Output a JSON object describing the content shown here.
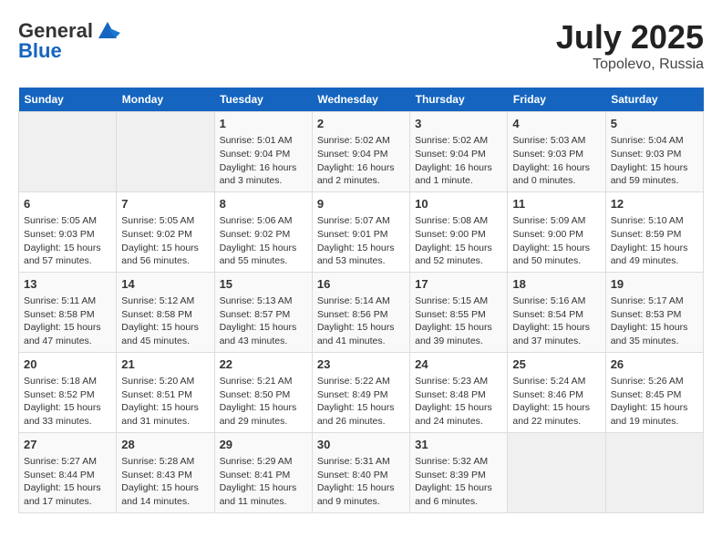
{
  "header": {
    "logo_general": "General",
    "logo_blue": "Blue",
    "month_year": "July 2025",
    "location": "Topolevo, Russia"
  },
  "calendar": {
    "days_of_week": [
      "Sunday",
      "Monday",
      "Tuesday",
      "Wednesday",
      "Thursday",
      "Friday",
      "Saturday"
    ],
    "weeks": [
      [
        {
          "day": "",
          "info": ""
        },
        {
          "day": "",
          "info": ""
        },
        {
          "day": "1",
          "info": "Sunrise: 5:01 AM\nSunset: 9:04 PM\nDaylight: 16 hours\nand 3 minutes."
        },
        {
          "day": "2",
          "info": "Sunrise: 5:02 AM\nSunset: 9:04 PM\nDaylight: 16 hours\nand 2 minutes."
        },
        {
          "day": "3",
          "info": "Sunrise: 5:02 AM\nSunset: 9:04 PM\nDaylight: 16 hours\nand 1 minute."
        },
        {
          "day": "4",
          "info": "Sunrise: 5:03 AM\nSunset: 9:03 PM\nDaylight: 16 hours\nand 0 minutes."
        },
        {
          "day": "5",
          "info": "Sunrise: 5:04 AM\nSunset: 9:03 PM\nDaylight: 15 hours\nand 59 minutes."
        }
      ],
      [
        {
          "day": "6",
          "info": "Sunrise: 5:05 AM\nSunset: 9:03 PM\nDaylight: 15 hours\nand 57 minutes."
        },
        {
          "day": "7",
          "info": "Sunrise: 5:05 AM\nSunset: 9:02 PM\nDaylight: 15 hours\nand 56 minutes."
        },
        {
          "day": "8",
          "info": "Sunrise: 5:06 AM\nSunset: 9:02 PM\nDaylight: 15 hours\nand 55 minutes."
        },
        {
          "day": "9",
          "info": "Sunrise: 5:07 AM\nSunset: 9:01 PM\nDaylight: 15 hours\nand 53 minutes."
        },
        {
          "day": "10",
          "info": "Sunrise: 5:08 AM\nSunset: 9:00 PM\nDaylight: 15 hours\nand 52 minutes."
        },
        {
          "day": "11",
          "info": "Sunrise: 5:09 AM\nSunset: 9:00 PM\nDaylight: 15 hours\nand 50 minutes."
        },
        {
          "day": "12",
          "info": "Sunrise: 5:10 AM\nSunset: 8:59 PM\nDaylight: 15 hours\nand 49 minutes."
        }
      ],
      [
        {
          "day": "13",
          "info": "Sunrise: 5:11 AM\nSunset: 8:58 PM\nDaylight: 15 hours\nand 47 minutes."
        },
        {
          "day": "14",
          "info": "Sunrise: 5:12 AM\nSunset: 8:58 PM\nDaylight: 15 hours\nand 45 minutes."
        },
        {
          "day": "15",
          "info": "Sunrise: 5:13 AM\nSunset: 8:57 PM\nDaylight: 15 hours\nand 43 minutes."
        },
        {
          "day": "16",
          "info": "Sunrise: 5:14 AM\nSunset: 8:56 PM\nDaylight: 15 hours\nand 41 minutes."
        },
        {
          "day": "17",
          "info": "Sunrise: 5:15 AM\nSunset: 8:55 PM\nDaylight: 15 hours\nand 39 minutes."
        },
        {
          "day": "18",
          "info": "Sunrise: 5:16 AM\nSunset: 8:54 PM\nDaylight: 15 hours\nand 37 minutes."
        },
        {
          "day": "19",
          "info": "Sunrise: 5:17 AM\nSunset: 8:53 PM\nDaylight: 15 hours\nand 35 minutes."
        }
      ],
      [
        {
          "day": "20",
          "info": "Sunrise: 5:18 AM\nSunset: 8:52 PM\nDaylight: 15 hours\nand 33 minutes."
        },
        {
          "day": "21",
          "info": "Sunrise: 5:20 AM\nSunset: 8:51 PM\nDaylight: 15 hours\nand 31 minutes."
        },
        {
          "day": "22",
          "info": "Sunrise: 5:21 AM\nSunset: 8:50 PM\nDaylight: 15 hours\nand 29 minutes."
        },
        {
          "day": "23",
          "info": "Sunrise: 5:22 AM\nSunset: 8:49 PM\nDaylight: 15 hours\nand 26 minutes."
        },
        {
          "day": "24",
          "info": "Sunrise: 5:23 AM\nSunset: 8:48 PM\nDaylight: 15 hours\nand 24 minutes."
        },
        {
          "day": "25",
          "info": "Sunrise: 5:24 AM\nSunset: 8:46 PM\nDaylight: 15 hours\nand 22 minutes."
        },
        {
          "day": "26",
          "info": "Sunrise: 5:26 AM\nSunset: 8:45 PM\nDaylight: 15 hours\nand 19 minutes."
        }
      ],
      [
        {
          "day": "27",
          "info": "Sunrise: 5:27 AM\nSunset: 8:44 PM\nDaylight: 15 hours\nand 17 minutes."
        },
        {
          "day": "28",
          "info": "Sunrise: 5:28 AM\nSunset: 8:43 PM\nDaylight: 15 hours\nand 14 minutes."
        },
        {
          "day": "29",
          "info": "Sunrise: 5:29 AM\nSunset: 8:41 PM\nDaylight: 15 hours\nand 11 minutes."
        },
        {
          "day": "30",
          "info": "Sunrise: 5:31 AM\nSunset: 8:40 PM\nDaylight: 15 hours\nand 9 minutes."
        },
        {
          "day": "31",
          "info": "Sunrise: 5:32 AM\nSunset: 8:39 PM\nDaylight: 15 hours\nand 6 minutes."
        },
        {
          "day": "",
          "info": ""
        },
        {
          "day": "",
          "info": ""
        }
      ]
    ]
  }
}
